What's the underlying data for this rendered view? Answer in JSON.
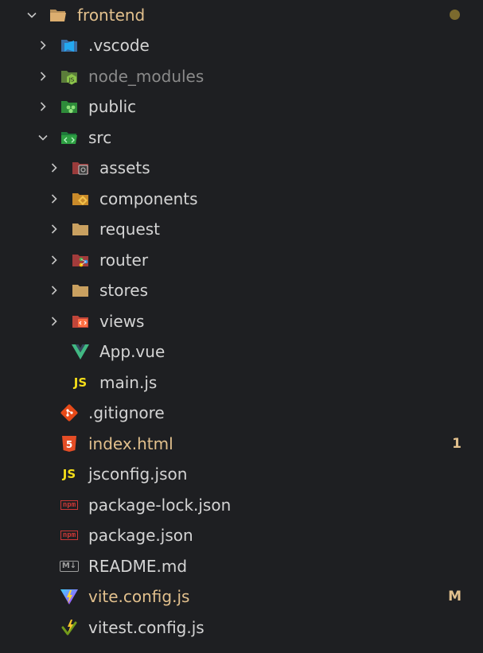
{
  "colors": {
    "modified": "#e2c08d",
    "dimmed": "#8a8a8a",
    "text": "#d4d4d4",
    "background": "#1e1f22",
    "dot": "#7b6a2e"
  },
  "root": {
    "label": "frontend",
    "state": "expanded"
  },
  "folders": {
    "vscode": {
      "label": ".vscode",
      "icon": "vscode-folder-icon"
    },
    "node_modules": {
      "label": "node_modules",
      "icon": "node-folder-icon"
    },
    "public": {
      "label": "public",
      "icon": "public-folder-icon"
    },
    "src": {
      "label": "src",
      "icon": "src-folder-icon"
    },
    "assets": {
      "label": "assets",
      "icon": "assets-folder-icon"
    },
    "components": {
      "label": "components",
      "icon": "components-folder-icon"
    },
    "request": {
      "label": "request",
      "icon": "folder-icon"
    },
    "router": {
      "label": "router",
      "icon": "router-folder-icon"
    },
    "stores": {
      "label": "stores",
      "icon": "folder-icon"
    },
    "views": {
      "label": "views",
      "icon": "views-folder-icon"
    }
  },
  "files": {
    "app_vue": {
      "label": "App.vue",
      "icon": "vue-icon"
    },
    "main_js": {
      "label": "main.js",
      "icon": "js-icon",
      "icon_text": "JS"
    },
    "gitignore": {
      "label": ".gitignore",
      "icon": "git-icon"
    },
    "index_html": {
      "label": "index.html",
      "icon": "html5-icon",
      "icon_text": "5",
      "badge": "1"
    },
    "jsconfig": {
      "label": "jsconfig.json",
      "icon": "jsconfig-icon",
      "icon_text": "JS"
    },
    "package_lock": {
      "label": "package-lock.json",
      "icon": "npm-icon",
      "icon_text": "npm"
    },
    "package": {
      "label": "package.json",
      "icon": "npm-icon",
      "icon_text": "npm"
    },
    "readme": {
      "label": "README.md",
      "icon": "markdown-icon",
      "icon_text": "M↓"
    },
    "vite_config": {
      "label": "vite.config.js",
      "icon": "vite-icon",
      "badge": "M"
    },
    "vitest_config": {
      "label": "vitest.config.js",
      "icon": "vitest-icon"
    }
  }
}
